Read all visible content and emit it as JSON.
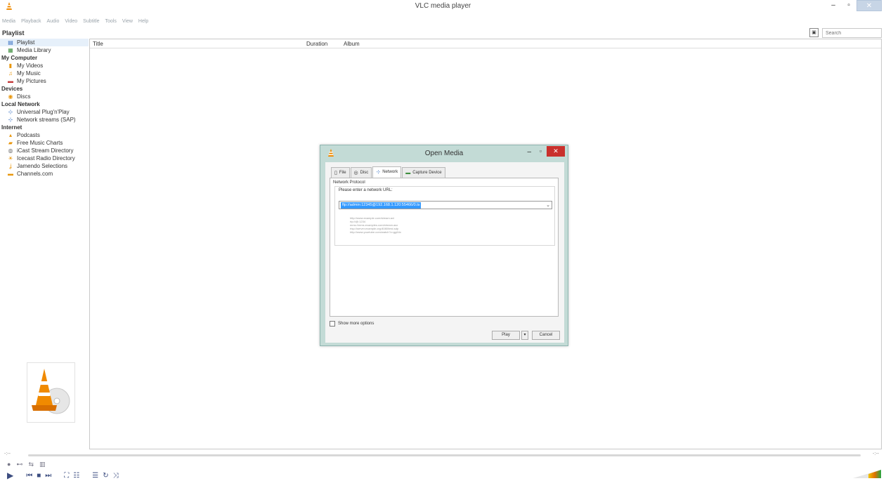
{
  "window": {
    "title": "VLC media player",
    "minimize": "–",
    "maximize": "▫",
    "close": "✕"
  },
  "menu": [
    "Media",
    "Playback",
    "Audio",
    "Video",
    "Subtitle",
    "Tools",
    "View",
    "Help"
  ],
  "playlist_heading": "Playlist",
  "search": {
    "placeholder": "Search"
  },
  "sidebar": {
    "sections": [
      {
        "title": "",
        "items": [
          {
            "label": "Playlist",
            "icon": "playlist-icon",
            "selected": true
          },
          {
            "label": "Media Library",
            "icon": "library-icon"
          }
        ]
      },
      {
        "title": "My Computer",
        "items": [
          {
            "label": "My Videos",
            "icon": "film-icon"
          },
          {
            "label": "My Music",
            "icon": "music-icon"
          },
          {
            "label": "My Pictures",
            "icon": "picture-icon"
          }
        ]
      },
      {
        "title": "Devices",
        "items": [
          {
            "label": "Discs",
            "icon": "disc-icon"
          }
        ]
      },
      {
        "title": "Local Network",
        "items": [
          {
            "label": "Universal Plug'n'Play",
            "icon": "network-icon"
          },
          {
            "label": "Network streams (SAP)",
            "icon": "network-icon"
          }
        ]
      },
      {
        "title": "Internet",
        "items": [
          {
            "label": "Podcasts",
            "icon": "podcast-icon"
          },
          {
            "label": "Free Music Charts",
            "icon": "chart-icon"
          },
          {
            "label": "iCast Stream Directory",
            "icon": "stream-icon"
          },
          {
            "label": "Icecast Radio Directory",
            "icon": "radio-icon"
          },
          {
            "label": "Jamendo Selections",
            "icon": "jamendo-icon"
          },
          {
            "label": "Channels.com",
            "icon": "channels-icon"
          }
        ]
      }
    ]
  },
  "columns": [
    "Title",
    "Duration",
    "Album"
  ],
  "seek": {
    "left": "-:--",
    "right": "-:--"
  },
  "dialog": {
    "title": "Open Media",
    "tabs": [
      {
        "label": "File",
        "icon": "file-icon"
      },
      {
        "label": "Disc",
        "icon": "disc-icon"
      },
      {
        "label": "Network",
        "icon": "network-icon",
        "active": true
      },
      {
        "label": "Capture Device",
        "icon": "capture-icon"
      }
    ],
    "group_title": "Network Protocol",
    "url_prompt": "Please enter a network URL:",
    "url_value": "ftp://admin:12345@192.168.1.120:55466/0.ts",
    "examples": [
      "http://www.example.com/stream.avi",
      "rtp://@:1234",
      "mms://mms.examples.com/stream.asx",
      "rtsp://server.example.org:8080/test.sdp",
      "http://www.yourtube.com/watch?v=gg64x"
    ],
    "more_options": "Show more options",
    "play": "Play",
    "cancel": "Cancel"
  }
}
